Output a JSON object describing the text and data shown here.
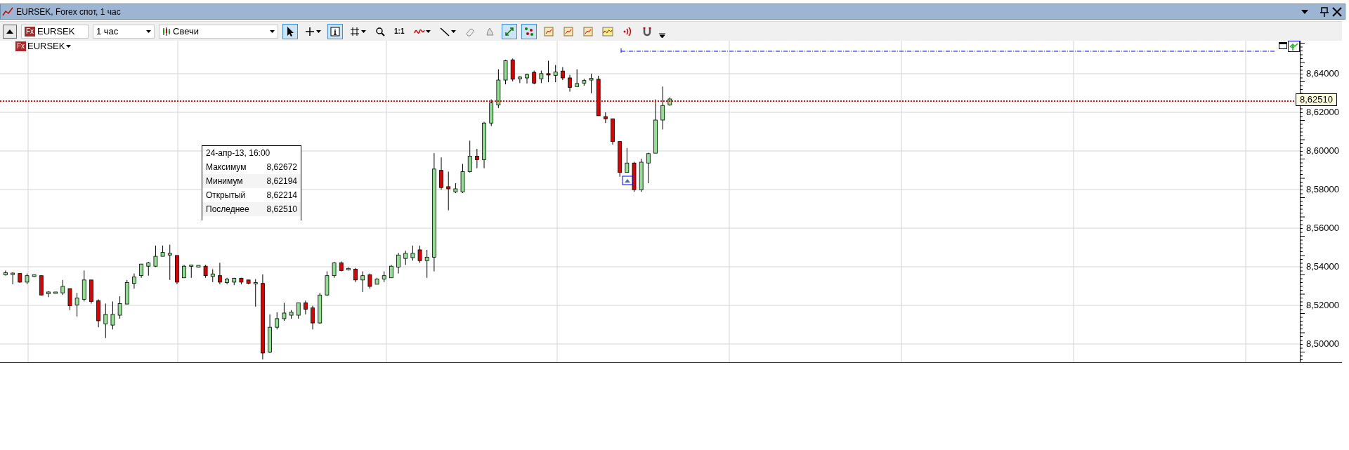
{
  "window": {
    "title": "EURSEK, Forex спот, 1 час"
  },
  "toolbar": {
    "symbol_badge": "Fx",
    "symbol": "EURSEK",
    "timeframe": "1 час",
    "chart_type": "Свечи",
    "buttons": [
      {
        "kind": "pointer",
        "selected": true,
        "caret": false
      },
      {
        "kind": "crosshair",
        "selected": false,
        "caret": true
      },
      {
        "kind": "info",
        "selected": true,
        "caret": false
      },
      {
        "kind": "grid",
        "selected": false,
        "caret": true
      },
      {
        "kind": "zoom",
        "selected": false,
        "caret": false
      },
      {
        "kind": "text",
        "label": "1:1",
        "selected": false,
        "caret": false
      },
      {
        "kind": "indicator",
        "selected": false,
        "caret": true
      },
      {
        "kind": "line",
        "selected": false,
        "caret": true
      },
      {
        "kind": "eraser",
        "selected": false,
        "caret": false
      },
      {
        "kind": "stamp",
        "selected": false,
        "caret": false
      },
      {
        "kind": "autoscale",
        "selected": true,
        "caret": false
      },
      {
        "kind": "dots",
        "selected": true,
        "caret": false
      },
      {
        "kind": "window",
        "selected": false,
        "caret": false
      },
      {
        "kind": "window",
        "selected": false,
        "caret": false
      },
      {
        "kind": "window",
        "selected": false,
        "caret": false
      },
      {
        "kind": "wave",
        "selected": false,
        "caret": false
      },
      {
        "kind": "signal",
        "selected": false,
        "caret": false
      },
      {
        "kind": "magnet",
        "selected": false,
        "caret": false
      }
    ]
  },
  "legend": {
    "symbol_badge": "Fx",
    "symbol": "EURSEK"
  },
  "tooltip": {
    "title": "24-апр-13, 16:00",
    "rows": [
      {
        "label": "Максимум",
        "value": "8,62672"
      },
      {
        "label": "Минимум",
        "value": "8,62194"
      },
      {
        "label": "Открытый",
        "value": "8,62214"
      },
      {
        "label": "Последнее",
        "value": "8,62510"
      }
    ]
  },
  "y_axis": {
    "labels": [
      "8,64000",
      "8,62000",
      "8,60000",
      "8,58000",
      "8,56000",
      "8,54000",
      "8,52000",
      "8,50000"
    ],
    "last_price": "8,62510"
  }
}
